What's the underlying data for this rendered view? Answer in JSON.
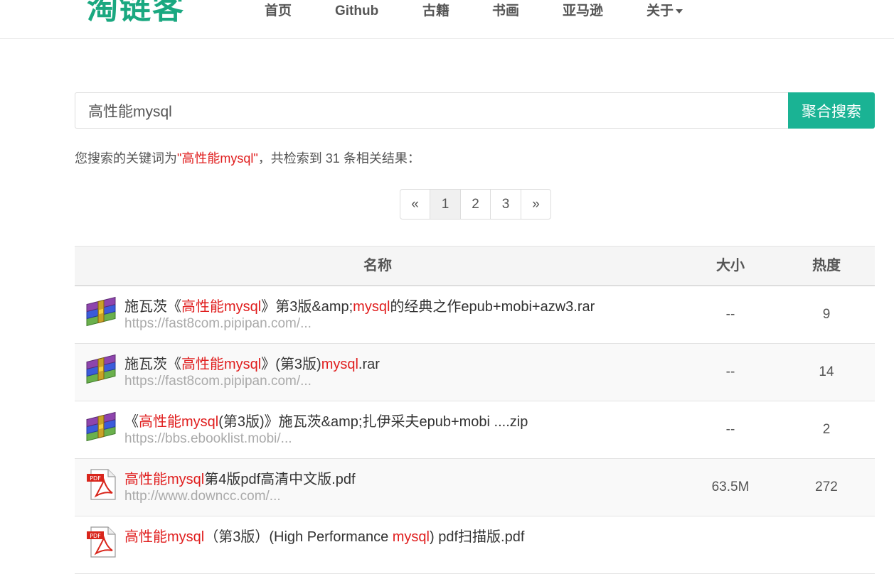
{
  "logo": "淘链客",
  "nav": [
    {
      "label": "首页"
    },
    {
      "label": "Github"
    },
    {
      "label": "古籍"
    },
    {
      "label": "书画"
    },
    {
      "label": "亚马逊"
    },
    {
      "label": "关于"
    }
  ],
  "search": {
    "value": "高性能mysql",
    "button_label": "聚合搜索"
  },
  "result_info": {
    "prefix": "您搜索的关键词为",
    "keyword": "\"高性能mysql\"",
    "suffix": "，共检索到 31 条相关结果："
  },
  "pagination": [
    "«",
    "1",
    "2",
    "3",
    "»"
  ],
  "table": {
    "headers": {
      "name": "名称",
      "size": "大小",
      "hot": "热度"
    },
    "rows": [
      {
        "icon": "rar-archive-icon",
        "name_parts": [
          {
            "text": "施瓦茨《",
            "hl": false
          },
          {
            "text": "高性能mysql",
            "hl": true
          },
          {
            "text": "》第3版&amp;",
            "hl": false
          },
          {
            "text": "mysql",
            "hl": true
          },
          {
            "text": "的经典之作epub+mobi+azw3.rar",
            "hl": false
          }
        ],
        "url": "https://fast8com.pipipan.com/...",
        "size": "--",
        "hot": "9"
      },
      {
        "icon": "rar-archive-icon",
        "name_parts": [
          {
            "text": "施瓦茨《",
            "hl": false
          },
          {
            "text": "高性能mysql",
            "hl": true
          },
          {
            "text": "》(第3版)",
            "hl": false
          },
          {
            "text": "mysql",
            "hl": true
          },
          {
            "text": ".rar",
            "hl": false
          }
        ],
        "url": "https://fast8com.pipipan.com/...",
        "size": "--",
        "hot": "14"
      },
      {
        "icon": "rar-archive-icon",
        "name_parts": [
          {
            "text": "《",
            "hl": false
          },
          {
            "text": "高性能mysql",
            "hl": true
          },
          {
            "text": "(第3版)》施瓦茨&amp;扎伊采夫epub+mobi ....zip",
            "hl": false
          }
        ],
        "url": "https://bbs.ebooklist.mobi/...",
        "size": "--",
        "hot": "2"
      },
      {
        "icon": "pdf-file-icon",
        "name_parts": [
          {
            "text": "高性能mysql",
            "hl": true
          },
          {
            "text": "第4版pdf高清中文版.pdf",
            "hl": false
          }
        ],
        "url": "http://www.downcc.com/...",
        "size": "63.5M",
        "hot": "272"
      },
      {
        "icon": "pdf-file-icon",
        "name_parts": [
          {
            "text": "高性能mysql",
            "hl": true
          },
          {
            "text": "（第3版）(High Performance ",
            "hl": false
          },
          {
            "text": "mysql",
            "hl": true
          },
          {
            "text": ") pdf扫描版.pdf",
            "hl": false
          }
        ],
        "url": "",
        "size": "",
        "hot": ""
      }
    ]
  },
  "colors": {
    "accent": "#1ab394",
    "logo": "#1aa880",
    "highlight": "#e01e1e"
  }
}
